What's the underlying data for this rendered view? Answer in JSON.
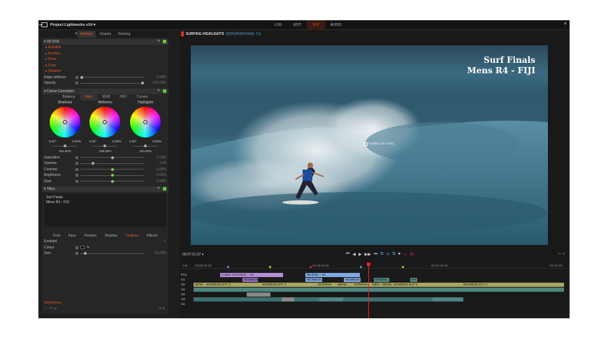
{
  "app": {
    "title": "Project Lightworks v14 ▾"
  },
  "modes": [
    "LOG",
    "EDIT",
    "VFX",
    "AUDIO"
  ],
  "active_mode": "VFX",
  "left_tabs": {
    "plus": "+",
    "items": [
      "Settings",
      "Graphs",
      "Routing"
    ],
    "active": "Settings"
  },
  "dve": {
    "title": "3D DVE",
    "subs": [
      "▸ Rotation",
      "▸ Position",
      "▸ Pivot",
      "▸ Crop",
      "▸ Shadow"
    ],
    "params": [
      {
        "label": "Edge softness",
        "value": "0.00%"
      },
      {
        "label": "Opacity",
        "value": "100.00%"
      }
    ]
  },
  "cc": {
    "title": "Colour Correction",
    "tabs": [
      "Balance",
      "Main",
      "RGB",
      "HSV",
      "Curves"
    ],
    "active_tab": "Main",
    "wheels": [
      {
        "name": "Shadows",
        "a": "0.00°",
        "b": "0.00%",
        "pct": "100.00%"
      },
      {
        "name": "Midtones",
        "a": "0.00°",
        "b": "0.00%",
        "pct": "100.00%"
      },
      {
        "name": "Highlights",
        "a": "0.00°",
        "b": "0.00%",
        "pct": "100.00%"
      }
    ],
    "params": [
      {
        "label": "Saturation",
        "value": "0.00%"
      },
      {
        "label": "Gamma",
        "value": "1.00"
      },
      {
        "label": "Contrast",
        "value": "0.00%"
      },
      {
        "label": "Brightness",
        "value": "0.00%"
      },
      {
        "label": "Gain",
        "value": "0.00%"
      }
    ]
  },
  "titles": {
    "title": "Titles",
    "text_line1": "Surf Finals",
    "text_line2": "Mens R4 - FIJI",
    "tabs": [
      "Font",
      "Face",
      "Position",
      "Shadow",
      "Outlines",
      "Effects"
    ],
    "active_tab": "Outlines",
    "props": [
      {
        "label": "Enabled",
        "value": "✓"
      },
      {
        "label": "Colour",
        "value": ""
      },
      {
        "label": "Size",
        "value": "10.00%"
      }
    ]
  },
  "keyframes": {
    "label": "Keyframes",
    "controls": "+ − ⏮ ⏭"
  },
  "viewer": {
    "title": "SURFING HIGHLIGHTS",
    "subtitle": "[INTERNATIONAL Tx]",
    "overlay_line1": "Surf Finals",
    "overlay_line2": "Mens R4 - FIJI",
    "position_label": "Position (3D DVE)",
    "timecode": "00:07:21.07 ▾",
    "transport": [
      "⏮",
      "◀",
      "▶",
      "▶▶",
      "⏭",
      "⧉",
      "⟲",
      "⧉",
      "⏹",
      "▭",
      "⊟"
    ],
    "right_controls": "∩ ∩"
  },
  "timeline": {
    "ruler": [
      "00:00:00.00",
      "00:05:00.00",
      "00:10:00.00",
      "00:15:00"
    ],
    "tracks": [
      "FX1",
      "V1",
      "V2",
      "A1",
      "A2",
      "A3",
      "A4"
    ],
    "clips": {
      "cc": "Colour Correction ~ V2",
      "dve": "3D DVE ~ V1",
      "w1": "WOMENS",
      "w2": "WOMENS",
      "w3": "WOMENS",
      "in1": "INTERN",
      "in2": "INT",
      "v2_1": "WOM",
      "v2_2": "WOMENS DAY 3",
      "v2_3": "WOMENS DAY 2",
      "v2_4": "INTERNA",
      "v2_5": "MENS",
      "v2_6": "INTERNA",
      "v2_7": "MEN",
      "v2_8": "MEND",
      "v2_9": "WOMENS DAY 2",
      "v2_10": "WOMENS DAY 2"
    }
  },
  "colors": {
    "accent": "#e2572c",
    "blue": "#4aa0c8",
    "green": "#66cc33"
  }
}
